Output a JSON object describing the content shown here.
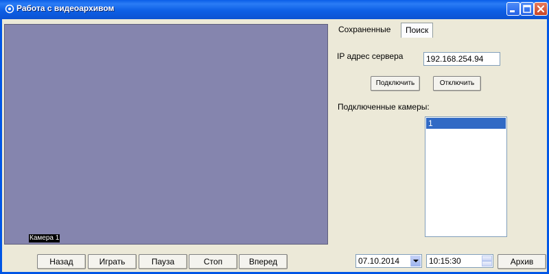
{
  "window": {
    "title": "Работа с видеоархивом"
  },
  "video": {
    "camera_label": "Камера 1",
    "background_color": "#8585ae"
  },
  "playback": {
    "back_label": "Назад",
    "play_label": "Играть",
    "pause_label": "Пауза",
    "stop_label": "Стоп",
    "forward_label": "Вперед"
  },
  "tabs": [
    {
      "label": "Сохраненные",
      "active": false
    },
    {
      "label": "Поиск",
      "active": true
    }
  ],
  "server": {
    "ip_label": "IP адрес сервера",
    "ip_value": "192.168.254.94",
    "connect_label": "Подключить",
    "disconnect_label": "Отключить"
  },
  "cameras": {
    "label": "Подключенные камеры:",
    "items": [
      "1"
    ]
  },
  "archive": {
    "date_value": "07.10.2014",
    "time_value": "10:15:30",
    "archive_label": "Архив"
  },
  "colors": {
    "titlebar": "#0a5ee8",
    "selection": "#316ac5",
    "window_bg": "#ece9d8"
  }
}
